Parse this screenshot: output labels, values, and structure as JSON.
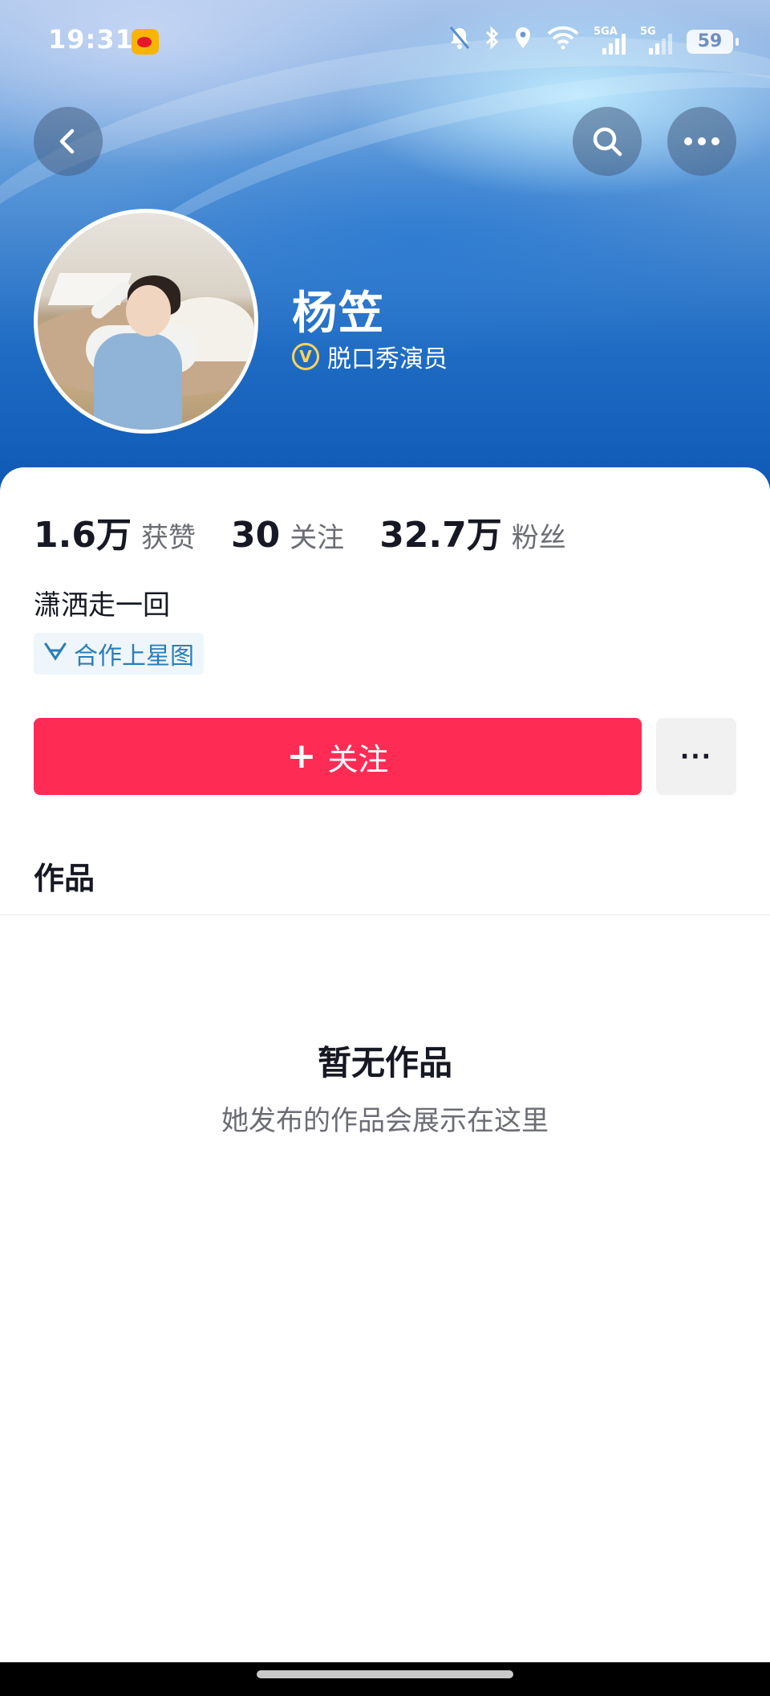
{
  "status_bar": {
    "time": "19:31",
    "battery": "59",
    "network_1": "5GA",
    "network_2": "5G",
    "icons": [
      "weibo-icon",
      "mute-bell-icon",
      "bluetooth-icon",
      "location-icon",
      "wifi-icon",
      "signal-icon",
      "signal-icon",
      "battery-icon"
    ]
  },
  "nav": {
    "back_icon": "chevron-left-icon",
    "search_icon": "search-icon",
    "more_icon": "more-horizontal-icon"
  },
  "profile": {
    "name": "杨笠",
    "verified_badge": "V",
    "verified_title": "脱口秀演员",
    "stats": [
      {
        "value": "1.6万",
        "label": "获赞"
      },
      {
        "value": "30",
        "label": "关注"
      },
      {
        "value": "32.7万",
        "label": "粉丝"
      }
    ],
    "bio": "潇洒走一回",
    "xingtu_label": "合作上星图"
  },
  "actions": {
    "follow_plus": "+",
    "follow_label": "关注",
    "more_label": "···"
  },
  "works": {
    "title": "作品",
    "empty_title": "暂无作品",
    "empty_subtitle": "她发布的作品会展示在这里"
  },
  "colors": {
    "accent": "#fe2c55",
    "verified": "#ffd35a",
    "link": "#2a7db8"
  }
}
